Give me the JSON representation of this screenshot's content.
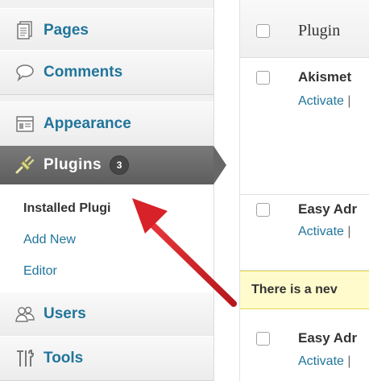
{
  "sidebar": {
    "pages": "Pages",
    "comments": "Comments",
    "appearance": "Appearance",
    "plugins": "Plugins",
    "plugins_badge": "3",
    "submenu": {
      "installed": "Installed Plugi",
      "add_new": "Add New",
      "editor": "Editor"
    },
    "users": "Users",
    "tools": "Tools"
  },
  "table": {
    "header": "Plugin",
    "rows": [
      {
        "name": "Akismet",
        "action": "Activate",
        "sep": "|"
      },
      {
        "name": "Easy Adr",
        "action": "Activate",
        "sep": "|"
      },
      {
        "name": "Easy Adr",
        "action": "Activate",
        "sep": "|"
      }
    ],
    "notice": "There is a nev"
  },
  "colors": {
    "link": "#21759b",
    "active_menu": "#676767",
    "notice_bg": "#fffbcc",
    "arrow": "#d62228"
  },
  "icons": [
    "pages-icon",
    "comments-icon",
    "appearance-icon",
    "plugins-icon",
    "users-icon",
    "tools-icon",
    "annotation-arrow"
  ]
}
